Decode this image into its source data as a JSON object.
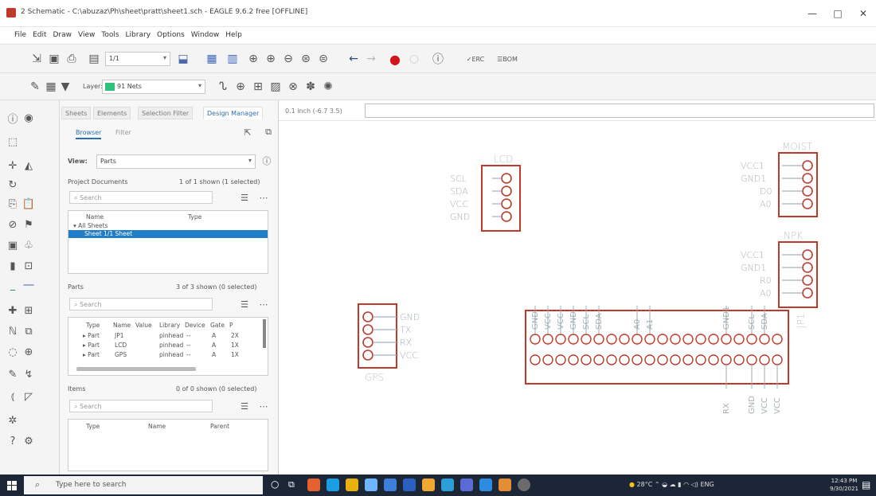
{
  "window": {
    "title": "2 Schematic - C:\\abuzaz\\Ph\\sheet\\pratt\\sheet1.sch - EAGLE 9.6.2 free [OFFLINE]",
    "minimize": "—",
    "maximize": "□",
    "close": "✕"
  },
  "menu": [
    "File",
    "Edit",
    "Draw",
    "View",
    "Tools",
    "Library",
    "Options",
    "Window",
    "Help"
  ],
  "toolbar": {
    "sheet_select": "1/1",
    "layer_label": "Layer:",
    "layer_value": "91 Nets",
    "layer_color": "#2ec27e"
  },
  "panel": {
    "tabs": [
      "Sheets",
      "Elements",
      "Selection Filter",
      "Design Manager"
    ],
    "subtabs": [
      "Browser",
      "Filter"
    ],
    "view_label": "View:",
    "view_value": "Parts",
    "project_docs": {
      "label": "Project Documents",
      "count": "1 of 1 shown (1 selected)",
      "search": "Search"
    },
    "docs_columns": [
      "Name",
      "Type"
    ],
    "docs_tree": [
      {
        "label": "All Sheets",
        "selected": false
      },
      {
        "label": "Sheet 1/1 Sheet",
        "selected": true
      }
    ],
    "parts": {
      "label": "Parts",
      "count": "3 of 3 shown (0 selected)",
      "search": "Search"
    },
    "parts_columns": [
      "Type",
      "Name",
      "Value",
      "Library",
      "Device",
      "Gate",
      "P"
    ],
    "parts_rows": [
      {
        "type": "Part",
        "name": "JP1",
        "library": "pinhead",
        "device": "--",
        "gate": "A",
        "p": "2X"
      },
      {
        "type": "Part",
        "name": "LCD",
        "library": "pinhead",
        "device": "--",
        "gate": "A",
        "p": "1X"
      },
      {
        "type": "Part",
        "name": "GPS",
        "library": "pinhead",
        "device": "--",
        "gate": "A",
        "p": "1X"
      }
    ],
    "items": {
      "label": "Items",
      "count": "0 of 0 shown (0 selected)",
      "search": "Search"
    },
    "items_columns": [
      "Type",
      "Name",
      "Parent"
    ]
  },
  "canvas": {
    "coordinate": "0.1 inch (-6.7 3.5)",
    "schematic": {
      "lcd": {
        "name": "LCD",
        "pins": [
          "SCL",
          "SDA",
          "VCC",
          "GND"
        ]
      },
      "moist": {
        "name": "MOIST",
        "pins": [
          "VCC1",
          "GND1",
          "D0",
          "A0"
        ]
      },
      "npk": {
        "name": "NPK",
        "pins": [
          "VCC1",
          "GND1",
          "R0",
          "A0"
        ]
      },
      "gps": {
        "name": "GPS",
        "pins": [
          "GND",
          "TX",
          "RX",
          "VCC"
        ]
      },
      "jp1": {
        "name": "JP1",
        "top_labels": [
          "GND",
          "VCC",
          "VCC",
          "GND",
          "SCL",
          "SDA",
          "A0",
          "A1",
          "GND1",
          "SCL",
          "SDA"
        ],
        "bottom_labels": [
          "RX",
          "GND",
          "VCC",
          "VCC"
        ]
      }
    }
  },
  "taskbar": {
    "search_placeholder": "Type here to search",
    "weather": "28°C",
    "time": "12:43 PM",
    "date": "9/30/2021",
    "lang": "ENG"
  }
}
